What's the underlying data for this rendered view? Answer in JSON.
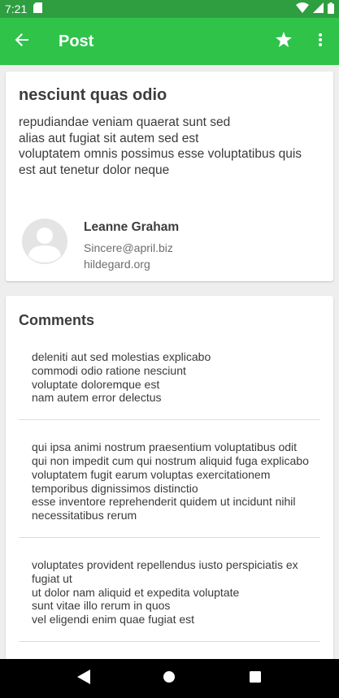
{
  "status_bar": {
    "time": "7:21",
    "icons": [
      "sd-card-icon",
      "wifi-icon",
      "cellular-signal-icon",
      "battery-icon"
    ]
  },
  "app_bar": {
    "title": "Post",
    "back_icon": "arrow-back-icon",
    "favorite_icon": "star-icon",
    "menu_icon": "more-vert-icon",
    "background": "#2fc34a"
  },
  "post": {
    "title": "nesciunt quas odio",
    "body": "repudiandae veniam quaerat sunt sed\nalias aut fugiat sit autem sed est\nvoluptatem omnis possimus esse voluptatibus quis\nest aut tenetur dolor neque",
    "author": {
      "name": "Leanne Graham",
      "email": "Sincere@april.biz",
      "website": "hildegard.org"
    }
  },
  "comments": {
    "heading": "Comments",
    "items": [
      {
        "body": "deleniti aut sed molestias explicabo\ncommodi odio ratione nesciunt\nvoluptate doloremque est\nnam autem error delectus"
      },
      {
        "body": "qui ipsa animi nostrum praesentium voluptatibus odit\nqui non impedit cum qui nostrum aliquid fuga explicabo\nvoluptatem fugit earum voluptas exercitationem temporibus dignissimos distinctio\nesse inventore reprehenderit quidem ut incidunt nihil necessitatibus rerum"
      },
      {
        "body": "voluptates provident repellendus iusto perspiciatis ex fugiat ut\nut dolor nam aliquid et expedita voluptate\nsunt vitae illo rerum in quos\nvel eligendi enim quae fugiat est"
      }
    ]
  },
  "nav_bar": {
    "icons": [
      "back-triangle-icon",
      "home-circle-icon",
      "recents-square-icon"
    ]
  }
}
